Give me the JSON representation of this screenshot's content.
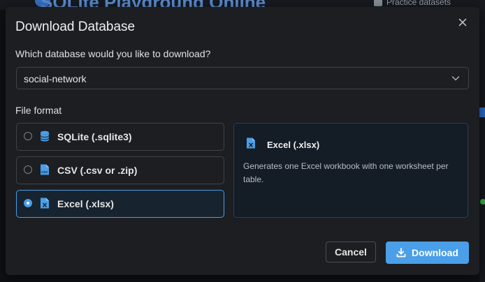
{
  "background": {
    "app_title": "SQLite Playground Online",
    "practice_link": "Practice datasets"
  },
  "dialog": {
    "title": "Download Database",
    "close_icon": "close-icon",
    "question": "Which database would you like to download?",
    "database_select": {
      "selected": "social-network",
      "icon": "chevron-down-icon"
    },
    "file_format_label": "File format",
    "formats": [
      {
        "label": "SQLite (.sqlite3)",
        "icon": "database-icon",
        "selected": false
      },
      {
        "label": "CSV (.csv or .zip)",
        "icon": "csv-file-icon",
        "selected": false
      },
      {
        "label": "Excel (.xlsx)",
        "icon": "excel-file-icon",
        "selected": true
      }
    ],
    "selected_format_info": {
      "title": "Excel (.xlsx)",
      "description": "Generates one Excel workbook with one worksheet per table.",
      "icon": "excel-file-icon"
    },
    "cancel_label": "Cancel",
    "download_label": "Download",
    "download_icon": "download-icon"
  },
  "colors": {
    "accent": "#4a9fe8",
    "modal_bg": "#1c1e22",
    "border": "#3f434a",
    "info_bg": "#141c26"
  }
}
